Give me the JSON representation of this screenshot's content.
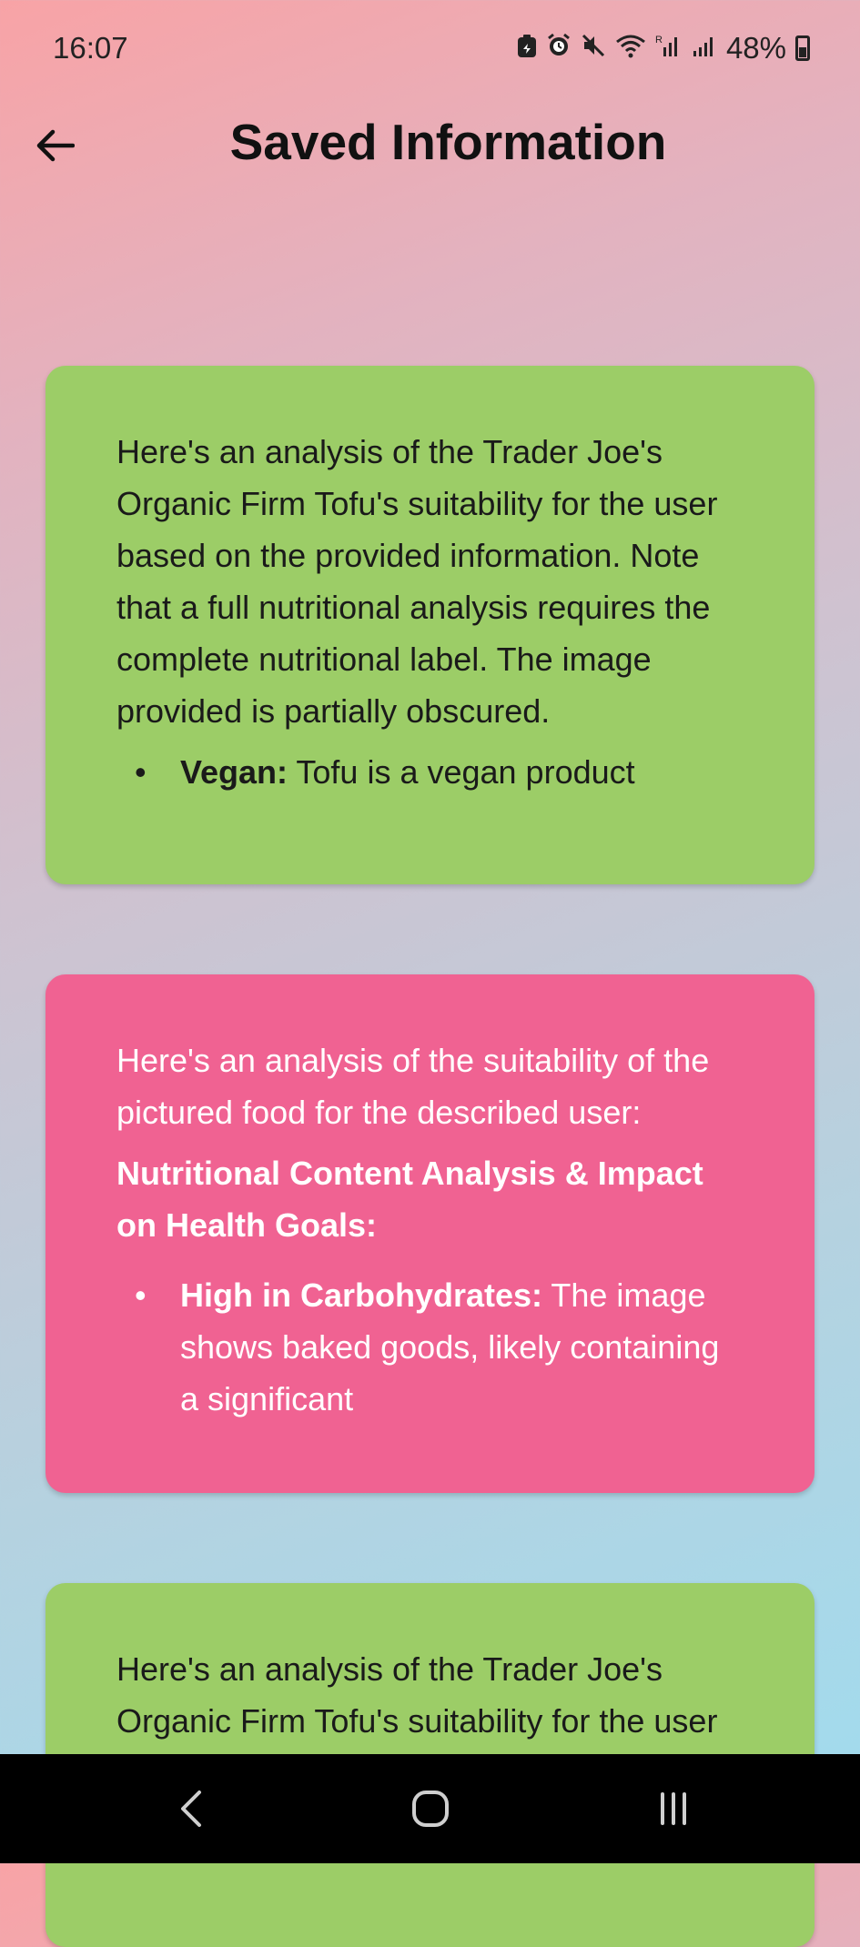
{
  "status_bar": {
    "time": "16:07",
    "battery_percent": "48%"
  },
  "app_bar": {
    "title": "Saved Information"
  },
  "cards": [
    {
      "color": "#9ccd67",
      "paragraph": "Here's an analysis of the Trader Joe's Organic Firm Tofu's suitability for the user based on the provided information.  Note that a full nutritional analysis requires the complete nutritional label.  The image provided is partially obscured.",
      "bullet_label": "Vegan:",
      "bullet_text": " Tofu is a vegan product"
    },
    {
      "color": "#f06292",
      "paragraph": "Here's an analysis of the suitability of the pictured food for the described user:",
      "heading": "Nutritional Content Analysis & Impact on Health Goals:",
      "bullet_label": "High in Carbohydrates:",
      "bullet_text": " The image shows baked goods, likely containing a significant"
    },
    {
      "color": "#9ccd67",
      "paragraph": "Here's an analysis of the Trader Joe's Organic Firm Tofu's suitability for the user based on the provided information."
    }
  ]
}
